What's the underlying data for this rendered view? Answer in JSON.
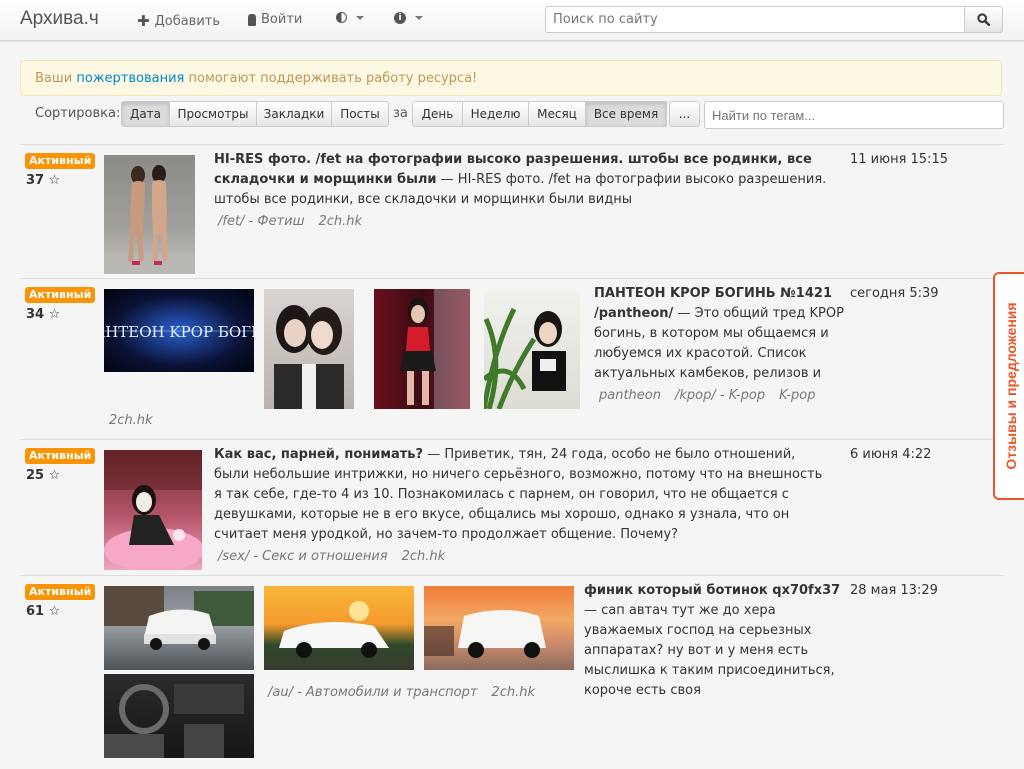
{
  "nav": {
    "brand": "Архива.ч",
    "add_label": "Добавить",
    "login_label": "Войти",
    "search_placeholder": "Поиск по сайту"
  },
  "alert": {
    "prefix": "Ваши ",
    "link": "пожертвования",
    "suffix": " помогают поддерживать работу ресурса!"
  },
  "sort": {
    "label": "Сортировка:",
    "options": [
      "Дата",
      "Просмотры",
      "Закладки",
      "Посты"
    ],
    "active": "Дата",
    "period_label": "за",
    "periods": [
      "День",
      "Неделю",
      "Месяц",
      "Все время",
      "..."
    ],
    "active_period": "Все время",
    "tag_placeholder": "Найти по тегам..."
  },
  "threads": [
    {
      "badge": "Активный",
      "stars": "37 ☆",
      "title": "HI-RES фото. /fet на фотографии высоко разрешения. штобы все родинки, все складочки и морщинки были",
      "excerpt": " — HI-RES фото. /fet на фотографии высоко разрешения. штобы все родинки, все складочки и морщинки были видны",
      "tags": [
        "/fet/ - Фетиш",
        "2ch.hk"
      ],
      "date": "11 июня 15:15"
    },
    {
      "badge": "Активный",
      "stars": "34 ☆",
      "title": "ПАНТЕОН KPOP БОГИНЬ №1421 /pantheon/",
      "excerpt": " — Это общий тред KPOP богинь, в котором мы общаемся и любуемся их красотой. Список актуальных камбеков, релизов и",
      "tags": [
        "pantheon",
        "/kpop/ - K-pop",
        "K-pop"
      ],
      "extra_tag": "2ch.hk",
      "banner_text": "АНТЕОН KPOP БОГИ",
      "date": "сегодня 5:39"
    },
    {
      "badge": "Активный",
      "stars": "25 ☆",
      "title": "Как вас, парней, понимать?",
      "excerpt": " — Приветик, тян, 24 года, особо не было отношений, были небольшие интрижки, но ничего серьёзного, возможно, потому что на внешность я так себе, где-то 4 из 10. Познакомилась с парнем, он говорил, что не общается с девушками, которые не в его вкусе, общались мы хорошо, однако я узнала, что он считает меня уродкой, но зачем-то продолжает общение. Почему?",
      "tags": [
        "/sex/ - Секс и отношения",
        "2ch.hk"
      ],
      "date": "6 июня 4:22"
    },
    {
      "badge": "Активный",
      "stars": "61 ☆",
      "title": "финик который ботинок qx70fx37",
      "excerpt": " — сап автач тут же до хера уважаемых господ на серьезных аппаратах? ну вот и у меня есть мыслишка к таким присоединиться, короче есть своя",
      "tags": [
        "/au/ - Автомобили и транспорт",
        "2ch.hk"
      ],
      "date": "28 мая 13:29"
    }
  ],
  "feedback_label": "Отзывы и предложения",
  "colors": {
    "badge": "#f89406",
    "link": "#0088cc",
    "feedback": "#e8562a"
  }
}
